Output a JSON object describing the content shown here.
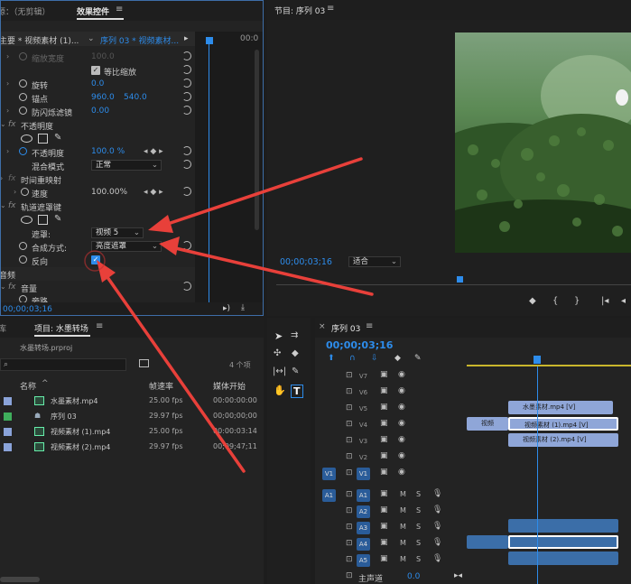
{
  "effect_controls": {
    "tab_inactive": "源：（无剪辑）",
    "tab_active": "效果控件",
    "master_label": "主要 * 视频素材 (1)...",
    "seq_label": "序列 03 * 视频素材...",
    "time_ruler": "00:0",
    "rows": {
      "scale_width": "缩放宽度",
      "scale_width_value": "100.0",
      "uniform_scale": "等比缩放",
      "rotation": "旋转",
      "rotation_value": "0.0",
      "anchor": "锚点",
      "anchor_x": "960.0",
      "anchor_y": "540.0",
      "antiflicker": "防闪烁滤镜",
      "antiflicker_value": "0.00",
      "opacity_fx": "不透明度",
      "opacity": "不透明度",
      "opacity_value": "100.0 %",
      "blend_mode": "混合模式",
      "blend_mode_value": "正常",
      "time_remap": "时间重映射",
      "speed": "速度",
      "speed_value": "100.00%",
      "track_matte": "轨道遮罩键",
      "matte": "遮罩:",
      "matte_value": "视频 5",
      "composite": "合成方式:",
      "composite_value": "亮度遮罩",
      "reverse": "反向",
      "audio": "音频",
      "volume": "音量",
      "bypass": "旁路"
    },
    "timecode": "00;00;03;16"
  },
  "program": {
    "title": "节目: 序列 03",
    "timecode": "00;00;03;16",
    "fit_label": "适合"
  },
  "project": {
    "tab_prev": "库",
    "tab_active": "项目: 水墨转场",
    "file_name": "水墨转场.prproj",
    "item_count": "4 个项",
    "headers": [
      "名称",
      "帧速率",
      "媒体开始"
    ],
    "items": [
      {
        "name": "水墨素材.mp4",
        "fps": "25.00 fps",
        "start": "00:00:00:00",
        "color": "#8aa3d9"
      },
      {
        "name": "序列 03",
        "fps": "29.97 fps",
        "start": "00;00;00;00",
        "color": "#3fae5c"
      },
      {
        "name": "视频素材 (1).mp4",
        "fps": "25.00 fps",
        "start": "00:00:03:14",
        "color": "#8aa3d9"
      },
      {
        "name": "视频素材 (2).mp4",
        "fps": "29.97 fps",
        "start": "00;09;47;11",
        "color": "#8aa3d9"
      }
    ]
  },
  "timeline": {
    "tab": "序列 03",
    "timecode": "00;00;03;16",
    "video_tracks": [
      "V7",
      "V6",
      "V5",
      "V4",
      "V3",
      "V2",
      "V1"
    ],
    "audio_tracks": [
      "A1",
      "A2",
      "A3",
      "A4",
      "A5"
    ],
    "source_v1": "V1",
    "source_a1": "A1",
    "master": "主声道",
    "master_value": "0.0",
    "clips": {
      "v5": "水墨素材.mp4 [V]",
      "v4": "视频素材 (1).mp4 [V]",
      "v3": "视频素材 (2).mp4 [V]",
      "v4_left": "视频"
    }
  },
  "colors": {
    "accent_blue": "#2d8ceb",
    "arrow_red": "#e8403a",
    "clip_video": "#8fa6d8",
    "clip_audio": "#3b6ea8"
  }
}
